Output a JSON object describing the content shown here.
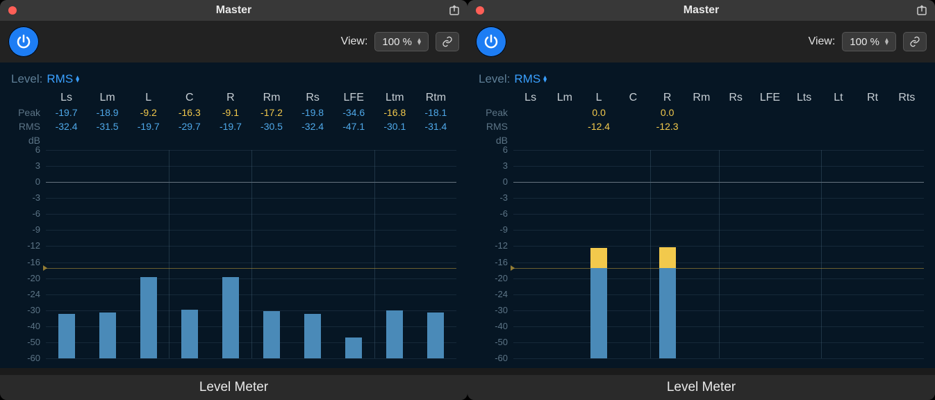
{
  "panels": [
    {
      "title": "Master",
      "view_label": "View:",
      "view_value": "100 %",
      "level_label": "Level:",
      "level_value": "RMS",
      "peak_label": "Peak",
      "rms_label": "RMS",
      "db_label": "dB",
      "footer": "Level Meter",
      "channels": [
        "Ls",
        "Lm",
        "L",
        "C",
        "R",
        "Rm",
        "Rs",
        "LFE",
        "Ltm",
        "Rtm"
      ],
      "peak": [
        "-19.7",
        "-18.9",
        "-9.2",
        "-16.3",
        "-9.1",
        "-17.2",
        "-19.8",
        "-34.6",
        "-16.8",
        "-18.1"
      ],
      "peak_color": [
        "blue",
        "blue",
        "yellow",
        "yellow",
        "yellow",
        "yellow",
        "blue",
        "blue",
        "yellow",
        "blue"
      ],
      "rms": [
        "-32.4",
        "-31.5",
        "-19.7",
        "-29.7",
        "-19.7",
        "-30.5",
        "-32.4",
        "-47.1",
        "-30.1",
        "-31.4"
      ],
      "rms_color": [
        "blue",
        "blue",
        "blue",
        "blue",
        "blue",
        "blue",
        "blue",
        "blue",
        "blue",
        "blue"
      ]
    },
    {
      "title": "Master",
      "view_label": "View:",
      "view_value": "100 %",
      "level_label": "Level:",
      "level_value": "RMS",
      "peak_label": "Peak",
      "rms_label": "RMS",
      "db_label": "dB",
      "footer": "Level Meter",
      "channels": [
        "Ls",
        "Lm",
        "L",
        "C",
        "R",
        "Rm",
        "Rs",
        "LFE",
        "Lts",
        "Lt",
        "Rt",
        "Rts"
      ],
      "peak": [
        "",
        "",
        "0.0",
        "",
        "0.0",
        "",
        "",
        "",
        "",
        "",
        "",
        ""
      ],
      "peak_color": [
        "",
        "",
        "yellow",
        "",
        "yellow",
        "",
        "",
        "",
        "",
        "",
        "",
        ""
      ],
      "rms": [
        "",
        "",
        "-12.4",
        "",
        "-12.3",
        "",
        "",
        "",
        "",
        "",
        "",
        ""
      ],
      "rms_color": [
        "",
        "",
        "yellow",
        "",
        "yellow",
        "",
        "",
        "",
        "",
        "",
        "",
        ""
      ]
    }
  ],
  "db_ticks": [
    "6",
    "3",
    "0",
    "-3",
    "-6",
    "-9",
    "-12",
    "-16",
    "-20",
    "-24",
    "-30",
    "-40",
    "-50",
    "-60"
  ],
  "chart_data": [
    {
      "type": "bar",
      "title": "Level Meter",
      "ylabel": "dB",
      "ylim": [
        -60,
        9
      ],
      "categories": [
        "Ls",
        "Lm",
        "L",
        "C",
        "R",
        "Rm",
        "Rs",
        "LFE",
        "Ltm",
        "Rtm"
      ],
      "series": [
        {
          "name": "Peak",
          "values": [
            -19.7,
            -18.9,
            -9.2,
            -16.3,
            -9.1,
            -17.2,
            -19.8,
            -34.6,
            -16.8,
            -18.1
          ]
        },
        {
          "name": "RMS",
          "values": [
            -32.4,
            -31.5,
            -19.7,
            -29.7,
            -19.7,
            -30.5,
            -32.4,
            -47.1,
            -30.1,
            -31.4
          ]
        }
      ],
      "indicator_db": -17.5
    },
    {
      "type": "bar",
      "title": "Level Meter",
      "ylabel": "dB",
      "ylim": [
        -60,
        9
      ],
      "categories": [
        "Ls",
        "Lm",
        "L",
        "C",
        "R",
        "Rm",
        "Rs",
        "LFE",
        "Lts",
        "Lt",
        "Rt",
        "Rts"
      ],
      "series": [
        {
          "name": "Peak",
          "values": [
            null,
            null,
            0.0,
            null,
            0.0,
            null,
            null,
            null,
            null,
            null,
            null,
            null
          ]
        },
        {
          "name": "RMS",
          "values": [
            null,
            null,
            -12.4,
            null,
            -12.3,
            null,
            null,
            null,
            null,
            null,
            null,
            null
          ]
        }
      ],
      "indicator_db": -17.5
    }
  ],
  "colors": {
    "accent": "#3aa0ff",
    "bar": "#4a8ab8",
    "cap": "#f2c94c",
    "bg": "#061624"
  }
}
